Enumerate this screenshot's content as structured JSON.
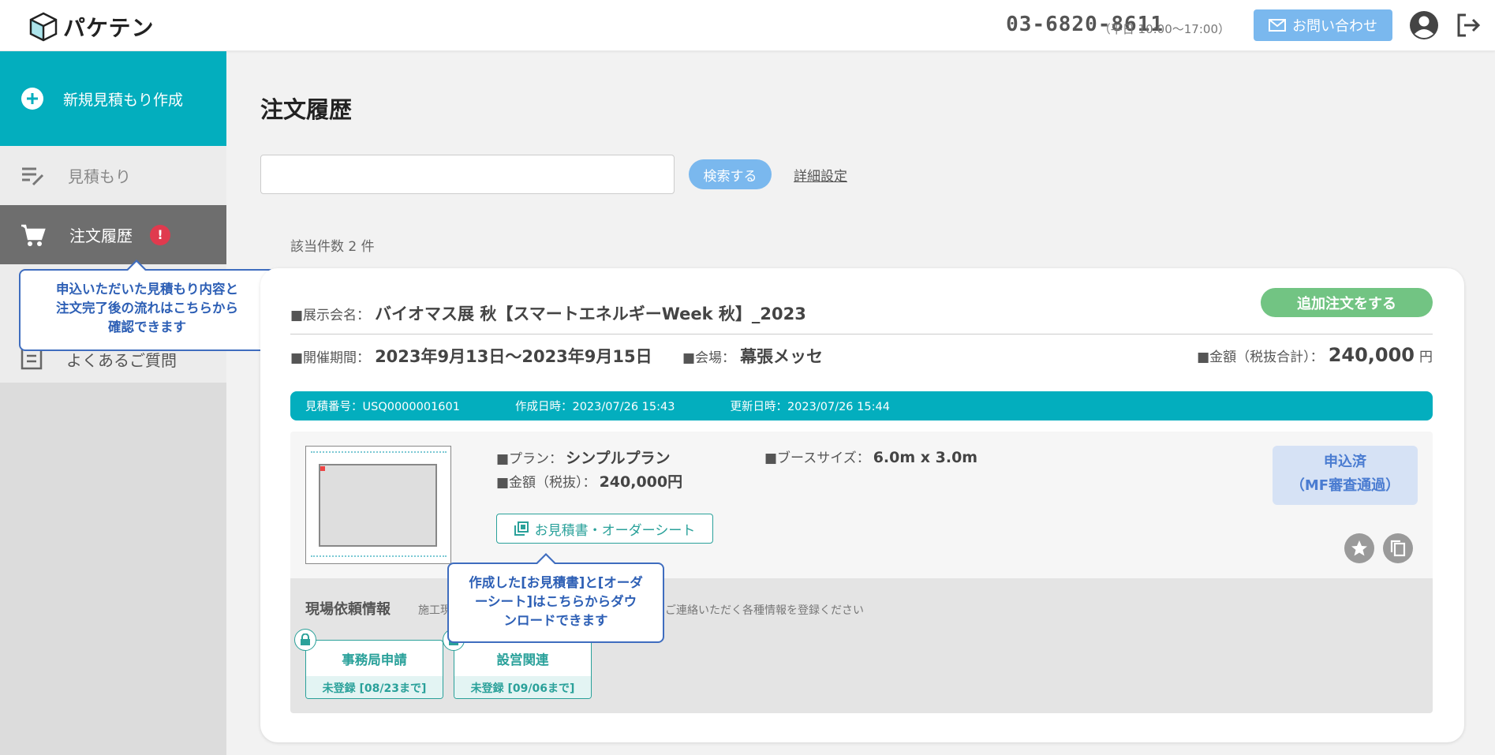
{
  "header": {
    "logo_text": "パケテン",
    "phone": "03-6820-8611",
    "hours": "（平日 10:00〜17:00）",
    "contact_label": "お問い合わせ",
    "icons": [
      "mail-icon",
      "user-icon",
      "logout-icon"
    ]
  },
  "sidebar": {
    "new_quote": "新規見積もり作成",
    "items": [
      {
        "label": "見積もり",
        "icon": "quote-list-icon"
      },
      {
        "label": "注文履歴",
        "icon": "cart-icon",
        "badge": "!"
      },
      {
        "label": "よくあるご質問",
        "icon": "faq-icon"
      }
    ],
    "tooltip": [
      "申込いただいた見積もり内容と",
      "注文完了後の流れはこちらから",
      "確認できます"
    ]
  },
  "main": {
    "title": "注文履歴",
    "search_placeholder": "",
    "search_button": "検索する",
    "detail_settings": "詳細設定",
    "count_text": "該当件数 2 件"
  },
  "order": {
    "exhibition_label": "■展示会名：",
    "exhibition_name": "バイオマス展 秋【スマートエネルギーWeek 秋】_2023",
    "add_order_button": "追加注文をする",
    "period_label": "■開催期間：",
    "period_value": "2023年9月13日〜2023年9月15日",
    "venue_label": "■会場：",
    "venue_value": "幕張メッセ",
    "amount_label": "■金額（税抜合計）：",
    "amount_value": "240,000",
    "amount_unit": "円",
    "meta": {
      "quote_no": "見積番号：USQ0000001601",
      "created": "作成日時：2023/07/26 15:43",
      "updated": "更新日時：2023/07/26 15:44"
    },
    "plan_label": "■プラン：",
    "plan_value": "シンプルプラン",
    "booth_label": "■ブースサイズ：",
    "booth_value": "6.0m x 3.0m",
    "inner_amount_label": "■金額（税抜）：",
    "inner_amount_value": "240,000円",
    "doc_button": "お見積書・オーダーシート",
    "status_line1": "申込済",
    "status_line2": "（MF審査通過）",
    "doc_tooltip": [
      "作成した[お見積書]と[オーダ",
      "ーシート]はこちらからダウ",
      "ンロードできます"
    ],
    "site": {
      "title": "現場依頼情報",
      "desc_start": "施工現",
      "desc_end": "ご連絡いただく各種情報を登録ください",
      "tiles": [
        {
          "title": "事務局申請",
          "status": "未登録 [08/23まで]"
        },
        {
          "title": "設営関連",
          "status": "未登録 [09/06まで]"
        }
      ]
    }
  },
  "colors": {
    "teal": "#03aebe",
    "blue": "#7ab8ee",
    "green": "#72c483",
    "tooltip_border": "#3f6dbf",
    "alert": "#e03a4e"
  }
}
